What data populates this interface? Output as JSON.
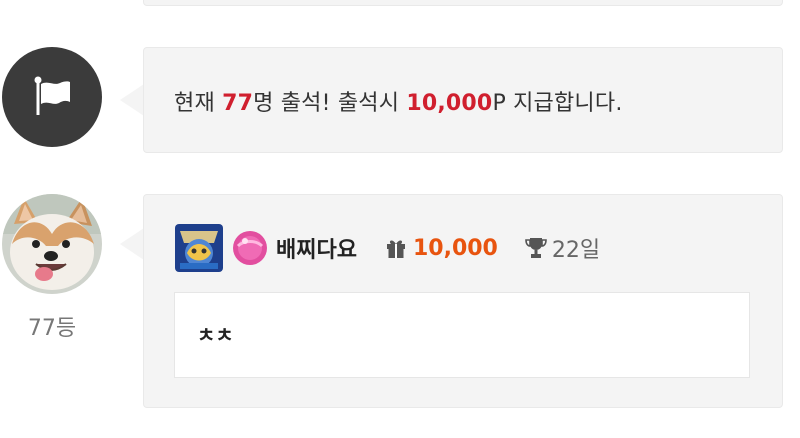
{
  "notice": {
    "prefix": "현재 ",
    "count": "77",
    "middle": "명 출석! 출석시 ",
    "reward": "10,000",
    "suffix": "P 지급합니다.",
    "icon": "flag-icon"
  },
  "entry": {
    "rank": "77등",
    "nickname": "배찌다요",
    "points": "10,000",
    "days": "22일",
    "comment": "ㅊㅊ",
    "icons": [
      "level-badge-icon",
      "gem-icon",
      "gift-icon",
      "trophy-icon",
      "corgi-avatar"
    ]
  },
  "colors": {
    "accent_red": "#d01f2e",
    "points_orange": "#e8540f",
    "card_bg": "#f4f4f4",
    "flag_circle": "#3b3b3b"
  }
}
